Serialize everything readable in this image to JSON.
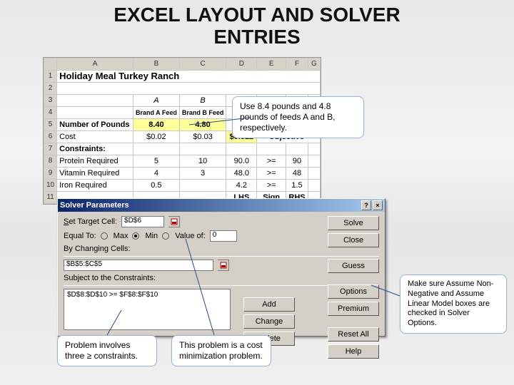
{
  "title_line1": "EXCEL LAYOUT AND SOLVER",
  "title_line2": "ENTRIES",
  "sheet": {
    "cols": [
      "",
      "A",
      "B",
      "C",
      "D",
      "E",
      "F",
      "G"
    ],
    "rows": [
      {
        "n": "1",
        "A": "Holiday Meal Turkey Ranch"
      },
      {
        "n": "2"
      },
      {
        "n": "3",
        "B": "A",
        "C": "B"
      },
      {
        "n": "4",
        "B": "Brand A Feed",
        "C": "Brand B Feed"
      },
      {
        "n": "5",
        "A": "Number of Pounds",
        "B": "8.40",
        "C": "4.80"
      },
      {
        "n": "6",
        "A": "Cost",
        "B": "$0.02",
        "C": "$0.03",
        "D": "$0.312",
        "E": "<- Objective"
      },
      {
        "n": "7",
        "A": "Constraints:"
      },
      {
        "n": "8",
        "A": "Protein Required",
        "B": "5",
        "C": "10",
        "D": "90.0",
        "E": ">=",
        "F": "90"
      },
      {
        "n": "9",
        "A": "Vitamin Required",
        "B": "4",
        "C": "3",
        "D": "48.0",
        "E": ">=",
        "F": "48"
      },
      {
        "n": "10",
        "A": "Iron Required",
        "B": "0.5",
        "D": "4.2",
        "E": ">=",
        "F": "1.5"
      },
      {
        "n": "11",
        "D": "LHS",
        "E": "Sign",
        "F": "RHS"
      }
    ]
  },
  "solver": {
    "title": "Solver Parameters",
    "targetLabel": "Set Target Cell:",
    "targetVal": "$D$6",
    "equalTo": "Equal To:",
    "optMax": "Max",
    "optMin": "Min",
    "optVal": "Value of:",
    "valOf": "0",
    "byChanging": "By Changing Cells:",
    "changingVal": "$B$5:$C$5",
    "subject": "Subject to the Constraints:",
    "constraint1": "$D$8:$D$10 >= $F$8:$F$10",
    "buttons": {
      "solve": "Solve",
      "close": "Close",
      "guess": "Guess",
      "options": "Options",
      "premium": "Premium",
      "add": "Add",
      "change": "Change",
      "delete": "Delete",
      "resetAll": "Reset All",
      "help": "Help"
    }
  },
  "callouts": {
    "c1": "Use 8.4 pounds and 4.8 pounds of feeds A and B, respectively.",
    "c2": "Make sure Assume Non-Negative and Assume Linear Model boxes are checked in Solver Options.",
    "c3": "Problem involves three ≥ constraints.",
    "c4": "This problem is a cost minimization problem."
  }
}
